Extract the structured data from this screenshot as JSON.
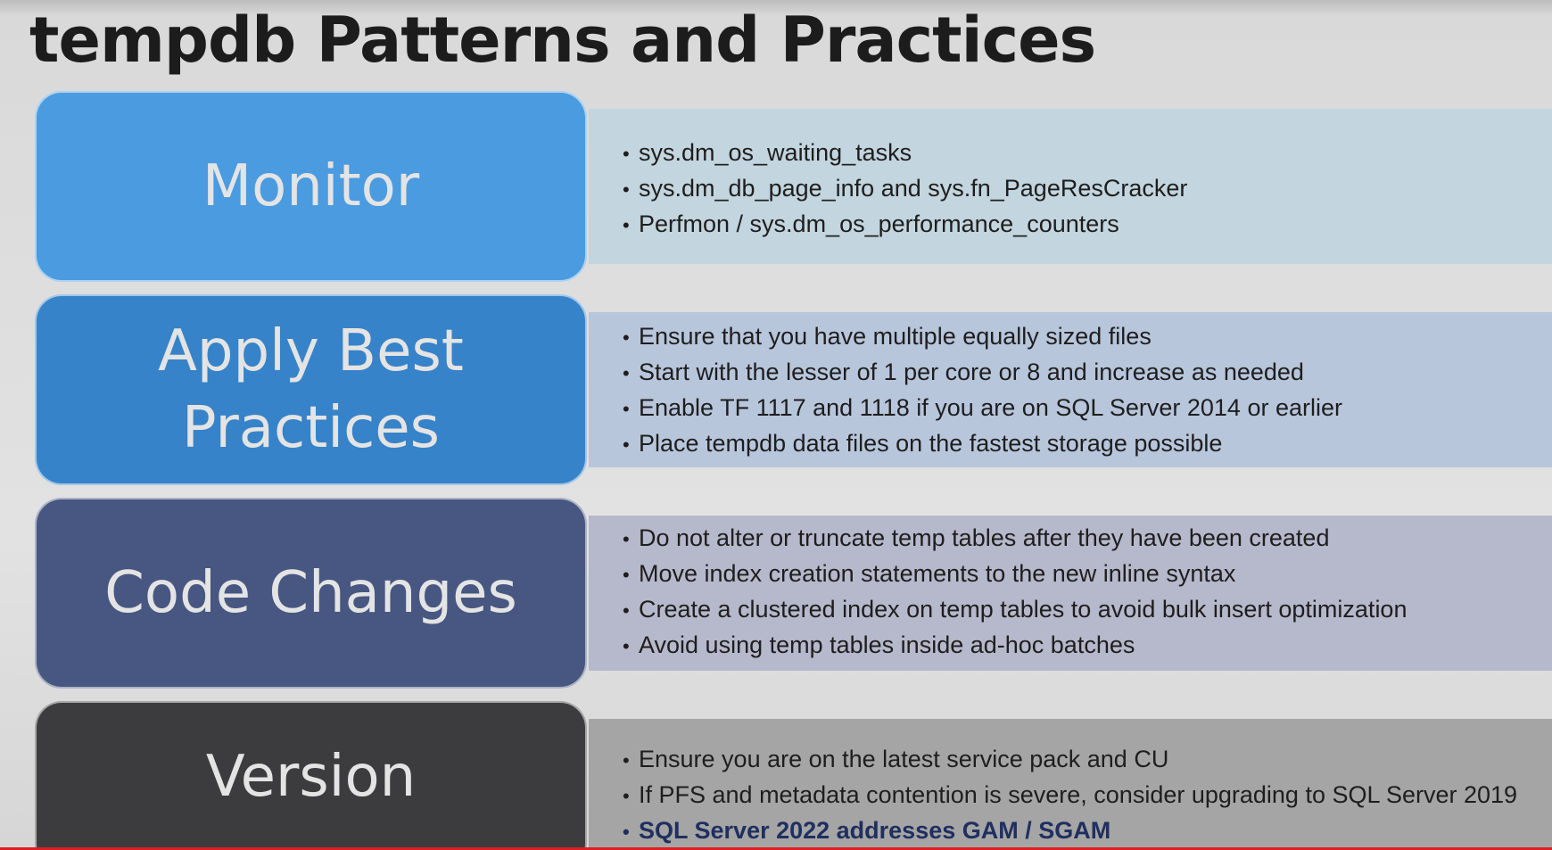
{
  "title": "tempdb Patterns and Practices",
  "colors": {
    "monitor_box": "#4a9be0",
    "monitor_panel": "#c3d5de",
    "best_box": "#3683c9",
    "best_panel": "#b8c6dc",
    "code_box": "#475781",
    "code_panel": "#b6b8cb",
    "version_box": "#3c3c3e",
    "version_panel": "#a5a5a5",
    "highlight_text": "#1f2f5f",
    "bottom_bar": "#e01d22"
  },
  "sections": [
    {
      "label": "Monitor",
      "items": [
        "sys.dm_os_waiting_tasks",
        "sys.dm_db_page_info and sys.fn_PageResCracker",
        "Perfmon / sys.dm_os_performance_counters"
      ]
    },
    {
      "label": "Apply Best Practices",
      "items": [
        "Ensure that you have multiple equally sized files",
        "Start with the lesser of 1 per core or 8 and increase as needed",
        "Enable TF 1117 and 1118 if you are on SQL Server 2014 or earlier",
        "Place tempdb data files on the fastest storage possible"
      ]
    },
    {
      "label": "Code Changes",
      "items": [
        "Do not alter or truncate temp tables after they have been created",
        "Move index creation statements to the new inline syntax",
        "Create a clustered index on temp tables to avoid bulk insert optimization",
        "Avoid using temp tables inside ad-hoc batches"
      ]
    },
    {
      "label": "Version",
      "items": [
        "Ensure you are on the latest service pack and CU",
        "If PFS and metadata contention is severe, consider upgrading to SQL Server 2019",
        "SQL Server 2022 addresses GAM / SGAM"
      ]
    }
  ]
}
